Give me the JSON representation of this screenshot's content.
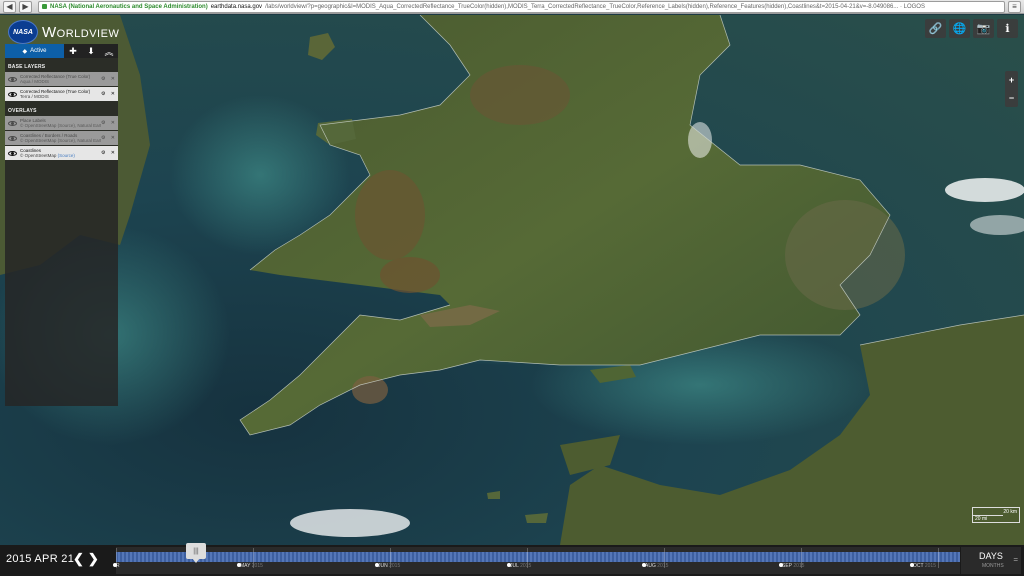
{
  "browser": {
    "back": "◀",
    "forward": "▶",
    "ev_label": "NASA (National Aeronautics and Space Administration)",
    "host": "earthdata.nasa.gov",
    "path": "/labs/worldview/?p=geographic&l=MODIS_Aqua_CorrectedReflectance_TrueColor(hidden),MODIS_Terra_CorrectedReflectance_TrueColor,Reference_Labels(hidden),Reference_Features(hidden),Coastlines&t=2015-04-21&v=-8.049086... · LOGOS"
  },
  "app": {
    "logo_text": "NASA",
    "title": "Worldview"
  },
  "panel": {
    "active_tab": "Active",
    "base_header": "BASE LAYERS",
    "overlays_header": "OVERLAYS",
    "base_layers": [
      {
        "name": "Corrected Reflectance (True Color)",
        "source": "Aqua / MODIS",
        "visible": false
      },
      {
        "name": "Corrected Reflectance (True Color)",
        "source": "Terra / MODIS",
        "visible": true
      }
    ],
    "overlays": [
      {
        "name": "Place Labels",
        "source": "© OpenStreetMap (Source), Natural Earth",
        "visible": false
      },
      {
        "name": "Coastlines / Borders / Roads",
        "source": "© OpenStreetMap (Source), Natural Earth",
        "visible": false
      },
      {
        "name": "Coastlines",
        "source": "© OpenStreetMap",
        "link": "(Source)",
        "visible": true
      }
    ]
  },
  "toolbar": {
    "icons": [
      "link-icon",
      "globe-icon",
      "camera-icon",
      "info-icon"
    ],
    "zoom_in": "+",
    "zoom_out": "−"
  },
  "scale": {
    "top": "20 km",
    "bottom": "20 mi"
  },
  "timeline": {
    "date": "2015 APR 21",
    "prev": "❮",
    "next": "❯",
    "handle": "|||",
    "months": [
      {
        "label": "MAY",
        "year": "2015"
      },
      {
        "label": "JUN",
        "year": "2015"
      },
      {
        "label": "JUL",
        "year": "2015"
      },
      {
        "label": "AUG",
        "year": "2015"
      },
      {
        "label": "SEP",
        "year": "2015"
      },
      {
        "label": "OCT",
        "year": "2015"
      }
    ],
    "left_fragment": "R",
    "unit": "DAYS",
    "unit_sub": "MONTHS",
    "menu": "="
  }
}
